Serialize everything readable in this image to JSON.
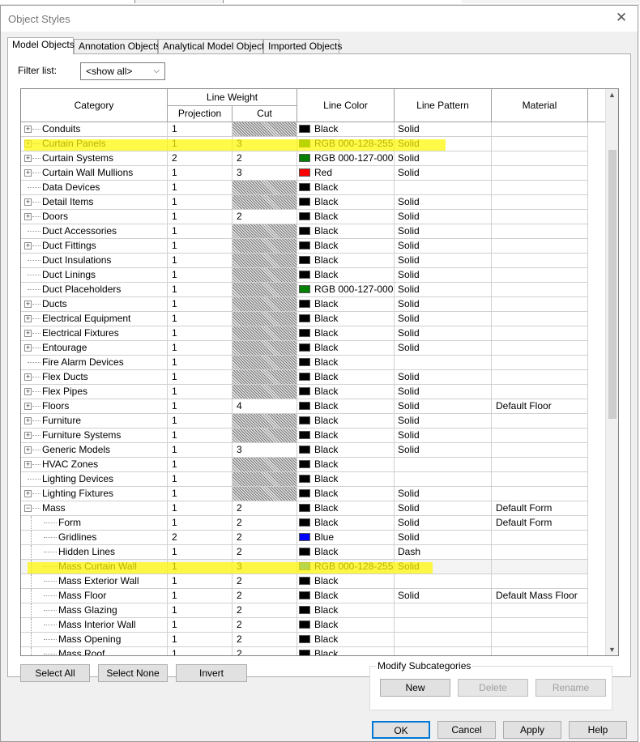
{
  "window": {
    "title": "Object Styles",
    "close_icon": "close-icon"
  },
  "tabs": [
    {
      "label": "Model Objects",
      "active": true
    },
    {
      "label": "Annotation Objects",
      "active": false
    },
    {
      "label": "Analytical Model Objects",
      "active": false
    },
    {
      "label": "Imported Objects",
      "active": false
    }
  ],
  "filter": {
    "label": "Filter list:",
    "value": "<show all>"
  },
  "table": {
    "headers": {
      "category": "Category",
      "line_weight": "Line Weight",
      "projection": "Projection",
      "cut": "Cut",
      "line_color": "Line Color",
      "line_pattern": "Line Pattern",
      "material": "Material"
    },
    "rows": [
      {
        "category": "Conduits",
        "expand": "+",
        "level": 0,
        "projection": "1",
        "cut": "",
        "cut_hatched": true,
        "color_name": "Black",
        "color_hex": "#000000",
        "pattern": "Solid",
        "material": ""
      },
      {
        "category": "Curtain Panels",
        "expand": "+",
        "level": 0,
        "projection": "1",
        "cut": "3",
        "cut_hatched": false,
        "color_name": "RGB 000-128-255",
        "color_hex": "#008000",
        "pattern": "Solid",
        "material": "",
        "highlighted": true
      },
      {
        "category": "Curtain Systems",
        "expand": "+",
        "level": 0,
        "projection": "2",
        "cut": "2",
        "cut_hatched": false,
        "color_name": "RGB 000-127-000",
        "color_hex": "#007f00",
        "pattern": "Solid",
        "material": ""
      },
      {
        "category": "Curtain Wall Mullions",
        "expand": "+",
        "level": 0,
        "projection": "1",
        "cut": "3",
        "cut_hatched": false,
        "color_name": "Red",
        "color_hex": "#ff0000",
        "pattern": "Solid",
        "material": ""
      },
      {
        "category": "Data Devices",
        "expand": "",
        "level": 0,
        "projection": "1",
        "cut": "",
        "cut_hatched": true,
        "color_name": "Black",
        "color_hex": "#000000",
        "pattern": "",
        "material": ""
      },
      {
        "category": "Detail Items",
        "expand": "+",
        "level": 0,
        "projection": "1",
        "cut": "",
        "cut_hatched": true,
        "color_name": "Black",
        "color_hex": "#000000",
        "pattern": "Solid",
        "material": ""
      },
      {
        "category": "Doors",
        "expand": "+",
        "level": 0,
        "projection": "1",
        "cut": "2",
        "cut_hatched": false,
        "color_name": "Black",
        "color_hex": "#000000",
        "pattern": "Solid",
        "material": ""
      },
      {
        "category": "Duct Accessories",
        "expand": "",
        "level": 0,
        "projection": "1",
        "cut": "",
        "cut_hatched": true,
        "color_name": "Black",
        "color_hex": "#000000",
        "pattern": "Solid",
        "material": ""
      },
      {
        "category": "Duct Fittings",
        "expand": "+",
        "level": 0,
        "projection": "1",
        "cut": "",
        "cut_hatched": true,
        "color_name": "Black",
        "color_hex": "#000000",
        "pattern": "Solid",
        "material": ""
      },
      {
        "category": "Duct Insulations",
        "expand": "",
        "level": 0,
        "projection": "1",
        "cut": "",
        "cut_hatched": true,
        "color_name": "Black",
        "color_hex": "#000000",
        "pattern": "Solid",
        "material": ""
      },
      {
        "category": "Duct Linings",
        "expand": "",
        "level": 0,
        "projection": "1",
        "cut": "",
        "cut_hatched": true,
        "color_name": "Black",
        "color_hex": "#000000",
        "pattern": "Solid",
        "material": ""
      },
      {
        "category": "Duct Placeholders",
        "expand": "",
        "level": 0,
        "projection": "1",
        "cut": "",
        "cut_hatched": true,
        "color_name": "RGB 000-127-000",
        "color_hex": "#007f00",
        "pattern": "Solid",
        "material": ""
      },
      {
        "category": "Ducts",
        "expand": "+",
        "level": 0,
        "projection": "1",
        "cut": "",
        "cut_hatched": true,
        "color_name": "Black",
        "color_hex": "#000000",
        "pattern": "Solid",
        "material": ""
      },
      {
        "category": "Electrical Equipment",
        "expand": "+",
        "level": 0,
        "projection": "1",
        "cut": "",
        "cut_hatched": true,
        "color_name": "Black",
        "color_hex": "#000000",
        "pattern": "Solid",
        "material": ""
      },
      {
        "category": "Electrical Fixtures",
        "expand": "+",
        "level": 0,
        "projection": "1",
        "cut": "",
        "cut_hatched": true,
        "color_name": "Black",
        "color_hex": "#000000",
        "pattern": "Solid",
        "material": ""
      },
      {
        "category": "Entourage",
        "expand": "+",
        "level": 0,
        "projection": "1",
        "cut": "",
        "cut_hatched": true,
        "color_name": "Black",
        "color_hex": "#000000",
        "pattern": "Solid",
        "material": ""
      },
      {
        "category": "Fire Alarm Devices",
        "expand": "",
        "level": 0,
        "projection": "1",
        "cut": "",
        "cut_hatched": true,
        "color_name": "Black",
        "color_hex": "#000000",
        "pattern": "",
        "material": ""
      },
      {
        "category": "Flex Ducts",
        "expand": "+",
        "level": 0,
        "projection": "1",
        "cut": "",
        "cut_hatched": true,
        "color_name": "Black",
        "color_hex": "#000000",
        "pattern": "Solid",
        "material": ""
      },
      {
        "category": "Flex Pipes",
        "expand": "+",
        "level": 0,
        "projection": "1",
        "cut": "",
        "cut_hatched": true,
        "color_name": "Black",
        "color_hex": "#000000",
        "pattern": "Solid",
        "material": ""
      },
      {
        "category": "Floors",
        "expand": "+",
        "level": 0,
        "projection": "1",
        "cut": "4",
        "cut_hatched": false,
        "color_name": "Black",
        "color_hex": "#000000",
        "pattern": "Solid",
        "material": "Default Floor"
      },
      {
        "category": "Furniture",
        "expand": "+",
        "level": 0,
        "projection": "1",
        "cut": "",
        "cut_hatched": true,
        "color_name": "Black",
        "color_hex": "#000000",
        "pattern": "Solid",
        "material": ""
      },
      {
        "category": "Furniture Systems",
        "expand": "+",
        "level": 0,
        "projection": "1",
        "cut": "",
        "cut_hatched": true,
        "color_name": "Black",
        "color_hex": "#000000",
        "pattern": "Solid",
        "material": ""
      },
      {
        "category": "Generic Models",
        "expand": "+",
        "level": 0,
        "projection": "1",
        "cut": "3",
        "cut_hatched": false,
        "color_name": "Black",
        "color_hex": "#000000",
        "pattern": "Solid",
        "material": ""
      },
      {
        "category": "HVAC Zones",
        "expand": "+",
        "level": 0,
        "projection": "1",
        "cut": "",
        "cut_hatched": true,
        "color_name": "Black",
        "color_hex": "#000000",
        "pattern": "",
        "material": ""
      },
      {
        "category": "Lighting Devices",
        "expand": "",
        "level": 0,
        "projection": "1",
        "cut": "",
        "cut_hatched": true,
        "color_name": "Black",
        "color_hex": "#000000",
        "pattern": "",
        "material": ""
      },
      {
        "category": "Lighting Fixtures",
        "expand": "+",
        "level": 0,
        "projection": "1",
        "cut": "",
        "cut_hatched": true,
        "color_name": "Black",
        "color_hex": "#000000",
        "pattern": "Solid",
        "material": ""
      },
      {
        "category": "Mass",
        "expand": "-",
        "level": 0,
        "projection": "1",
        "cut": "2",
        "cut_hatched": false,
        "color_name": "Black",
        "color_hex": "#000000",
        "pattern": "Solid",
        "material": "Default Form"
      },
      {
        "category": "Form",
        "expand": "",
        "level": 1,
        "projection": "1",
        "cut": "2",
        "cut_hatched": false,
        "color_name": "Black",
        "color_hex": "#000000",
        "pattern": "Solid",
        "material": "Default Form"
      },
      {
        "category": "Gridlines",
        "expand": "",
        "level": 1,
        "projection": "2",
        "cut": "2",
        "cut_hatched": false,
        "color_name": "Blue",
        "color_hex": "#0000ff",
        "pattern": "Solid",
        "material": ""
      },
      {
        "category": "Hidden Lines",
        "expand": "",
        "level": 1,
        "projection": "1",
        "cut": "2",
        "cut_hatched": false,
        "color_name": "Black",
        "color_hex": "#000000",
        "pattern": "Dash",
        "material": ""
      },
      {
        "category": "Mass Curtain Wall",
        "expand": "",
        "level": 1,
        "projection": "1",
        "cut": "3",
        "cut_hatched": false,
        "color_name": "RGB 000-128-255",
        "color_hex": "#0080ff",
        "pattern": "Solid",
        "material": "",
        "highlighted": true,
        "selected": true
      },
      {
        "category": "Mass Exterior Wall",
        "expand": "",
        "level": 1,
        "projection": "1",
        "cut": "2",
        "cut_hatched": false,
        "color_name": "Black",
        "color_hex": "#000000",
        "pattern": "",
        "material": ""
      },
      {
        "category": "Mass Floor",
        "expand": "",
        "level": 1,
        "projection": "1",
        "cut": "2",
        "cut_hatched": false,
        "color_name": "Black",
        "color_hex": "#000000",
        "pattern": "Solid",
        "material": "Default Mass Floor"
      },
      {
        "category": "Mass Glazing",
        "expand": "",
        "level": 1,
        "projection": "1",
        "cut": "2",
        "cut_hatched": false,
        "color_name": "Black",
        "color_hex": "#000000",
        "pattern": "",
        "material": ""
      },
      {
        "category": "Mass Interior Wall",
        "expand": "",
        "level": 1,
        "projection": "1",
        "cut": "2",
        "cut_hatched": false,
        "color_name": "Black",
        "color_hex": "#000000",
        "pattern": "",
        "material": ""
      },
      {
        "category": "Mass Opening",
        "expand": "",
        "level": 1,
        "projection": "1",
        "cut": "2",
        "cut_hatched": false,
        "color_name": "Black",
        "color_hex": "#000000",
        "pattern": "",
        "material": ""
      },
      {
        "category": "Mass Roof",
        "expand": "",
        "level": 1,
        "projection": "1",
        "cut": "2",
        "cut_hatched": false,
        "color_name": "Black",
        "color_hex": "#000000",
        "pattern": "",
        "material": ""
      }
    ]
  },
  "buttons": {
    "select_all": "Select All",
    "select_none": "Select None",
    "invert": "Invert",
    "modify_group": "Modify Subcategories",
    "new": "New",
    "delete": "Delete",
    "rename": "Rename",
    "ok": "OK",
    "cancel": "Cancel",
    "apply": "Apply",
    "help": "Help"
  },
  "colors": {
    "highlight": "#fff600",
    "selection_border": "#0078d7"
  }
}
